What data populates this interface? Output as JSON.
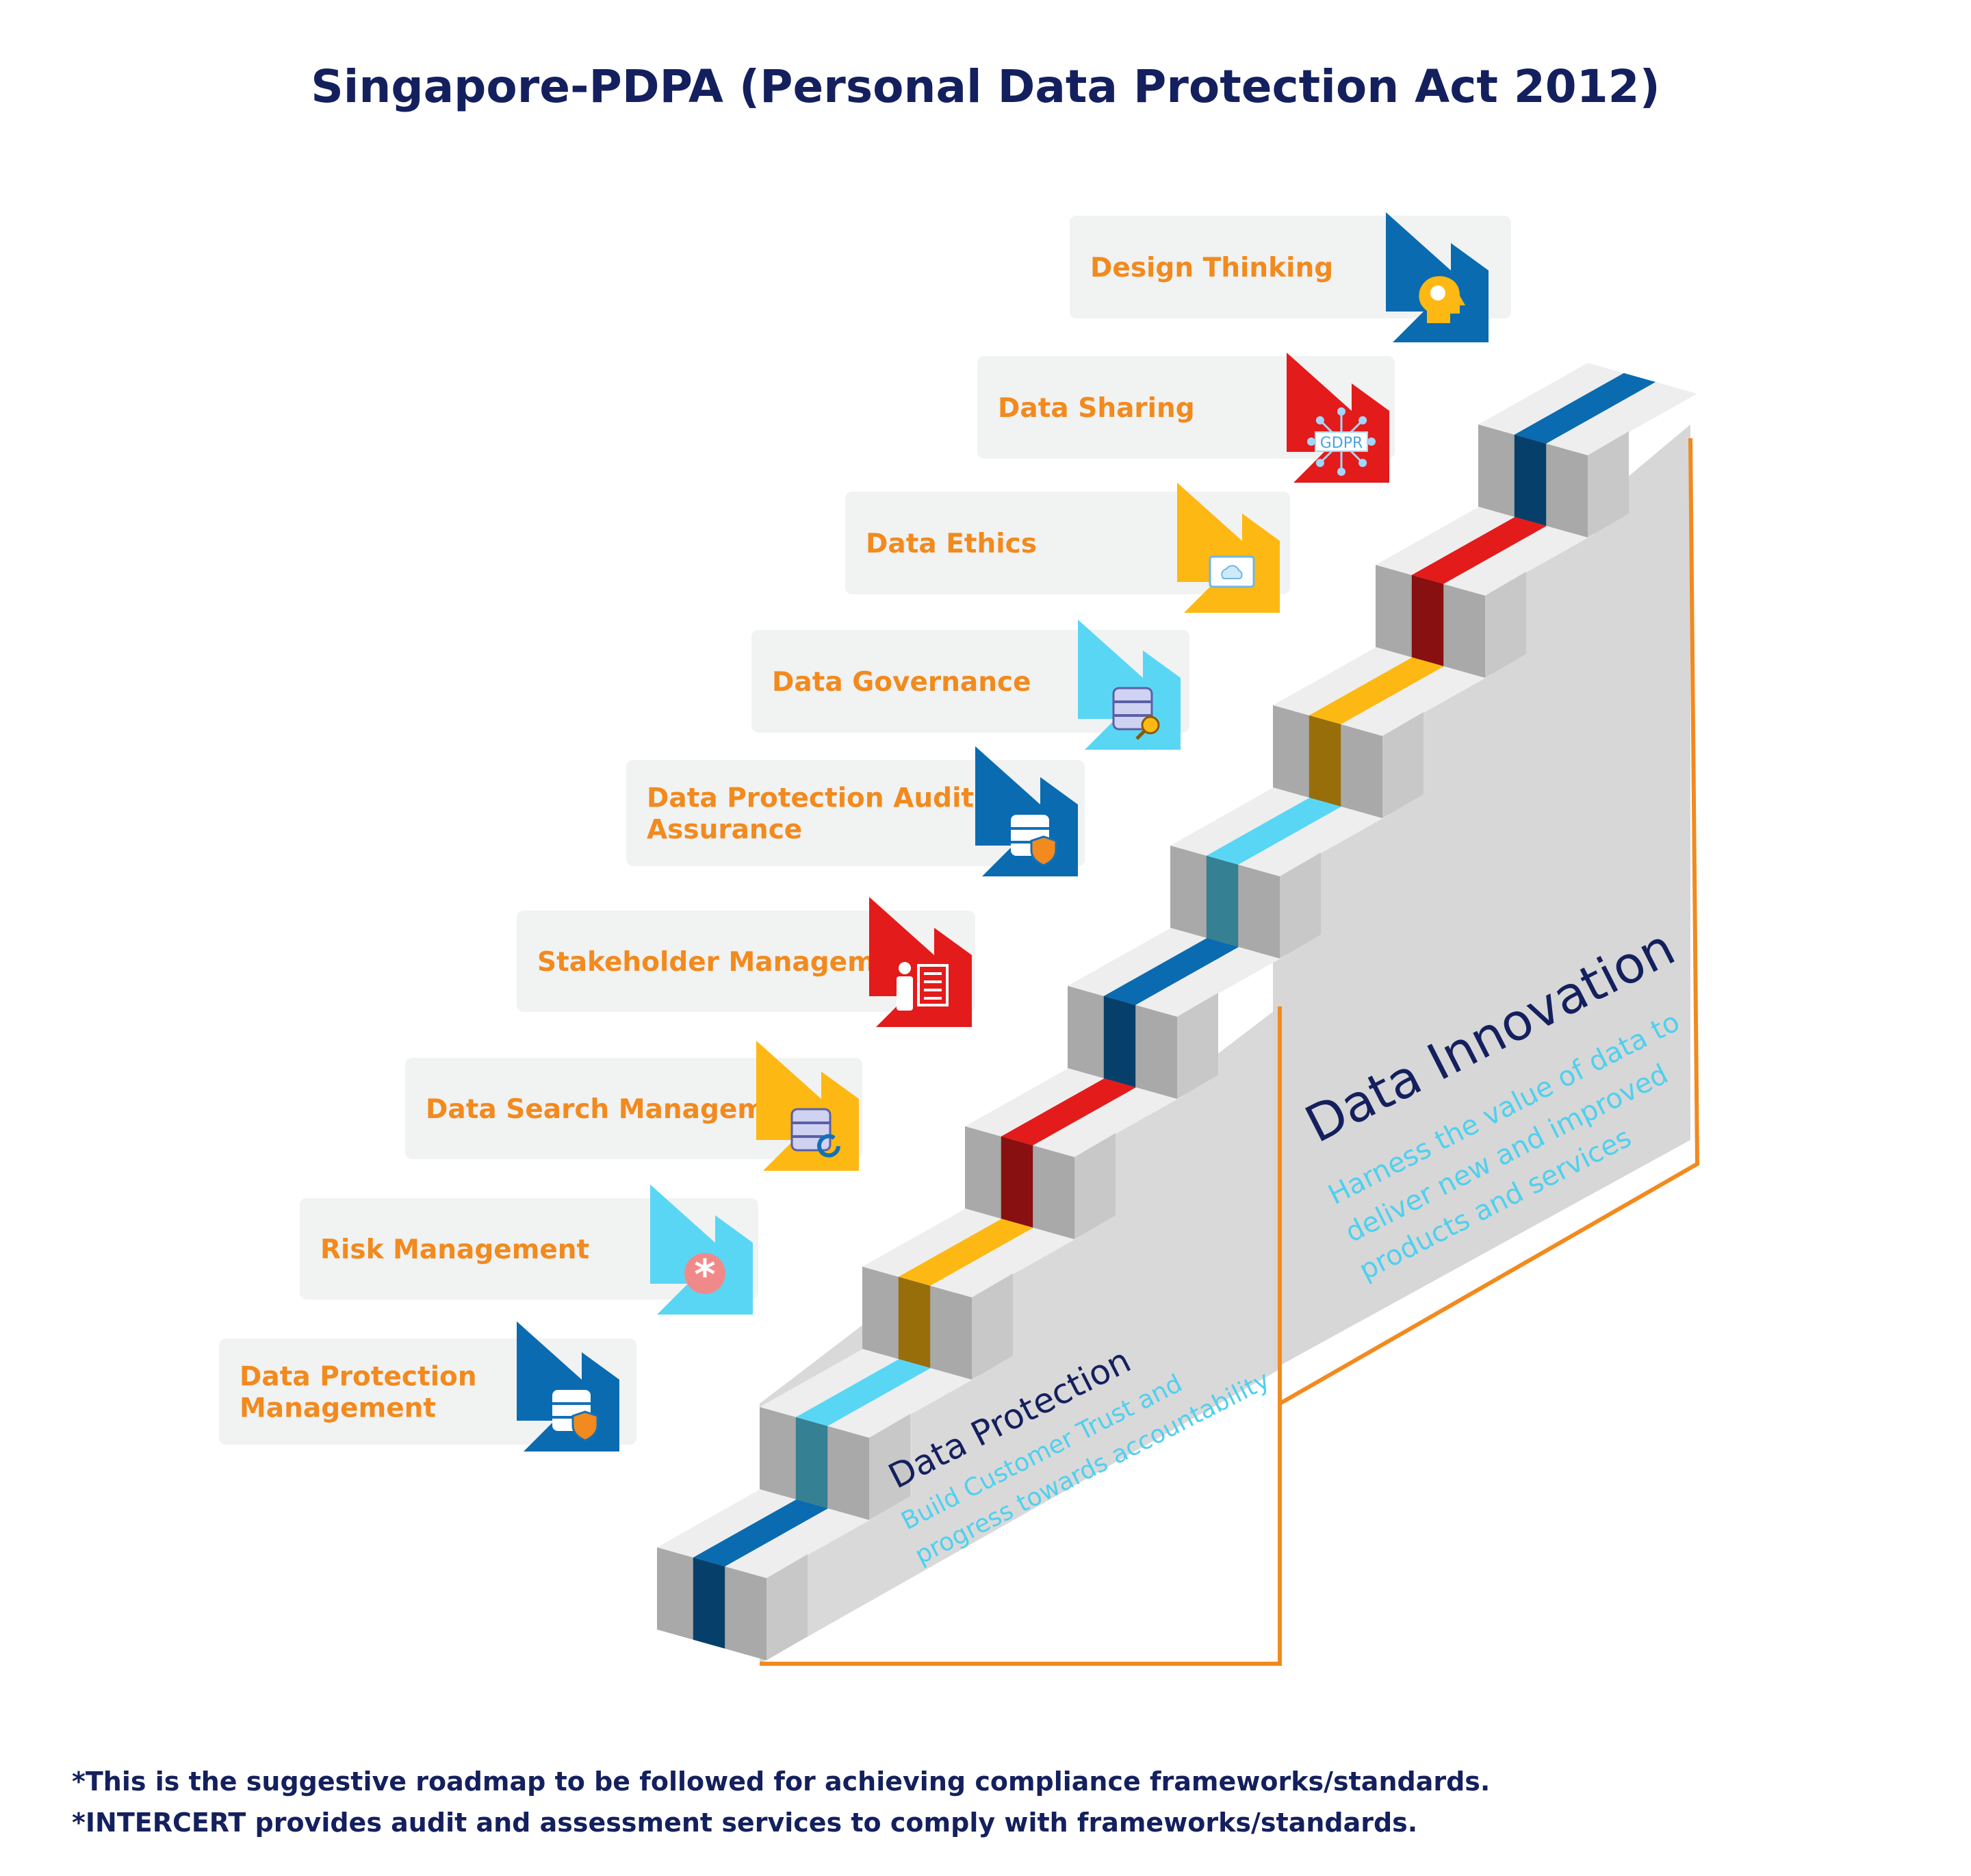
{
  "title": "Singapore-PDPA (Personal Data Protection Act 2012)",
  "steps": [
    {
      "label": "Data Protection Management",
      "color": "#0a6bb0",
      "icon": "database-shield-icon"
    },
    {
      "label": "Risk Management",
      "color": "#5ad6f5",
      "icon": "asterisk-badge-icon"
    },
    {
      "label": "Data Search Management",
      "color": "#fdb813",
      "icon": "database-refresh-icon"
    },
    {
      "label": "Stakeholder Management",
      "color": "#e31b1b",
      "icon": "presenter-list-icon"
    },
    {
      "label": "Data Protection Audit & Assurance",
      "color": "#0a6bb0",
      "icon": "database-shield-icon"
    },
    {
      "label": "Data Governance",
      "color": "#5ad6f5",
      "icon": "database-key-icon"
    },
    {
      "label": "Data Ethics",
      "color": "#fdb813",
      "icon": "cloud-folder-icon"
    },
    {
      "label": "Data Sharing",
      "color": "#e31b1b",
      "icon": "gdpr-network-icon",
      "icon_text": "GDPR"
    },
    {
      "label": "Design Thinking",
      "color": "#0a6bb0",
      "icon": "head-lightbulb-icon"
    }
  ],
  "phases": {
    "protection": {
      "title": "Data Protection",
      "subtitle_line1": "Build Customer Trust and",
      "subtitle_line2": "progress towards accountability"
    },
    "innovation": {
      "title": "Data Innovation",
      "subtitle_line1": "Harness the value of data to",
      "subtitle_line2": "deliver new and improved",
      "subtitle_line3": "products and services"
    }
  },
  "footnotes": [
    "*This is the suggestive roadmap to be followed for achieving compliance frameworks/standards.",
    "*INTERCERT provides audit and assessment services to comply with frameworks/standards."
  ],
  "colors": {
    "title": "#14205e",
    "label": "#f28a1e",
    "label_box": "#f1f2f2",
    "accent_text": "#4fd0ee",
    "outline": "#f28a1e"
  }
}
